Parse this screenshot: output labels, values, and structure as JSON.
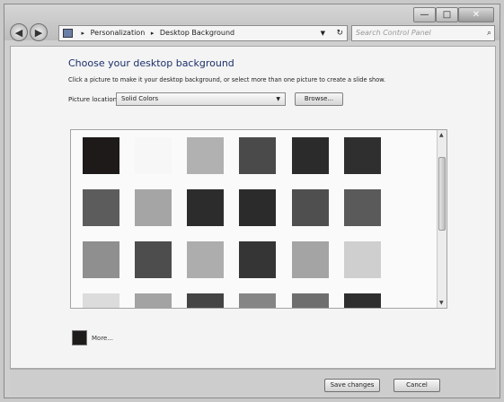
{
  "titlebar": {
    "caption_buttons": {
      "minimize": "—",
      "maximize": "□",
      "close": "✕"
    }
  },
  "nav": {
    "back_icon": "◀",
    "forward_icon": "▶",
    "breadcrumb": [
      "Personalization",
      "Desktop Background"
    ],
    "breadcrumb_separator": "▸",
    "search_placeholder": "Search Control Panel",
    "search_icon": "⌕",
    "refresh_icon": "↻"
  },
  "main": {
    "heading": "Choose your desktop background",
    "instruction": "Click a picture to make it your desktop background, or select more than one picture to create a slide show.",
    "picture_location_label": "Picture location:",
    "picture_location_value": "Solid Colors",
    "browse_label": "Browse..."
  },
  "swatches": [
    {
      "row": 0,
      "col": 0,
      "color": "#1e1a1a"
    },
    {
      "row": 0,
      "col": 1,
      "color": "#f7f7f7"
    },
    {
      "row": 0,
      "col": 2,
      "color": "#b1b1b1"
    },
    {
      "row": 0,
      "col": 3,
      "color": "#4a4a4a"
    },
    {
      "row": 0,
      "col": 4,
      "color": "#2b2b2b"
    },
    {
      "row": 0,
      "col": 5,
      "color": "#2f2f2f"
    },
    {
      "row": 1,
      "col": 0,
      "color": "#5c5c5c"
    },
    {
      "row": 1,
      "col": 1,
      "color": "#a5a5a5"
    },
    {
      "row": 1,
      "col": 2,
      "color": "#2c2c2c"
    },
    {
      "row": 1,
      "col": 3,
      "color": "#2b2b2b"
    },
    {
      "row": 1,
      "col": 4,
      "color": "#4f4f4f"
    },
    {
      "row": 1,
      "col": 5,
      "color": "#5a5a5a"
    },
    {
      "row": 2,
      "col": 0,
      "color": "#8f8f8f"
    },
    {
      "row": 2,
      "col": 1,
      "color": "#4d4d4d"
    },
    {
      "row": 2,
      "col": 2,
      "color": "#adadad"
    },
    {
      "row": 2,
      "col": 3,
      "color": "#353535"
    },
    {
      "row": 2,
      "col": 4,
      "color": "#a4a4a4"
    },
    {
      "row": 2,
      "col": 5,
      "color": "#cfcfcf"
    },
    {
      "row": 3,
      "col": 0,
      "color": "#dcdcdc"
    },
    {
      "row": 3,
      "col": 1,
      "color": "#a3a3a3"
    },
    {
      "row": 3,
      "col": 2,
      "color": "#444444"
    },
    {
      "row": 3,
      "col": 3,
      "color": "#858585"
    },
    {
      "row": 3,
      "col": 4,
      "color": "#6e6e6e"
    },
    {
      "row": 3,
      "col": 5,
      "color": "#2e2e2e"
    }
  ],
  "more": {
    "label": "More...",
    "color": "#1e1b1b"
  },
  "footer": {
    "save_label": "Save changes",
    "cancel_label": "Cancel"
  }
}
